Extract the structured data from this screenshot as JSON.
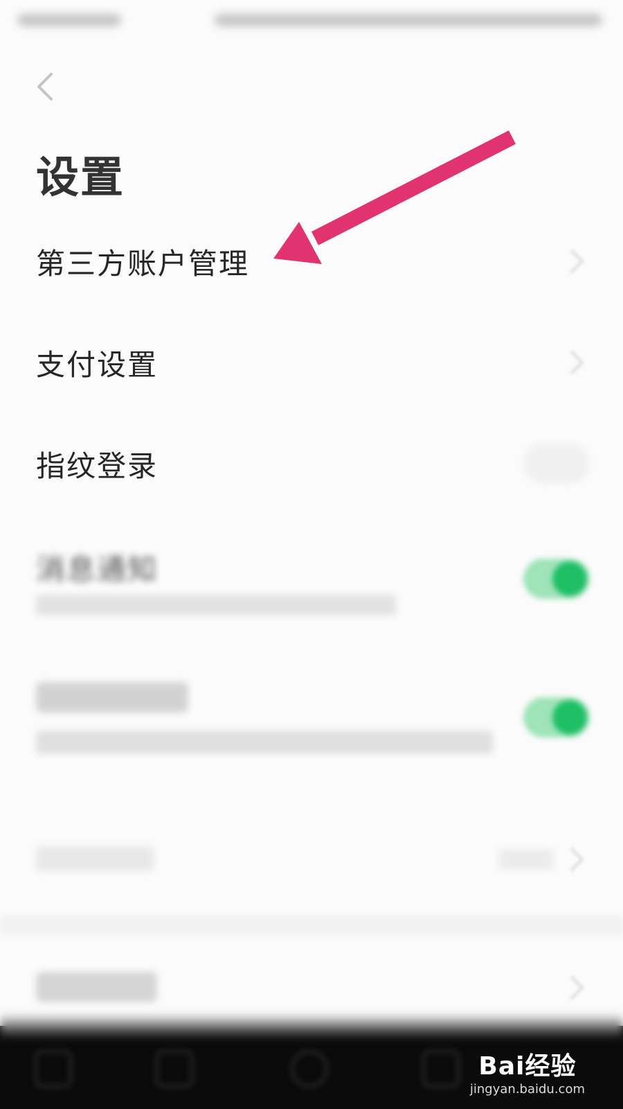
{
  "header": {
    "title": "设置",
    "back_icon": "chevron-left-icon"
  },
  "settings": {
    "third_party_accounts": "第三方账户管理",
    "payment_settings": "支付设置",
    "fingerprint_login": "指纹登录",
    "notifications": {
      "label": "消息通知",
      "enabled": true
    },
    "personalized": {
      "enabled": true
    }
  },
  "colors": {
    "toggle_on": "#1fbf66",
    "annotation_arrow": "#e0336f",
    "nav_bar": "#0b0b0b"
  },
  "watermark": {
    "logo": "Bai经验",
    "url": "jingyan.baidu.com"
  }
}
